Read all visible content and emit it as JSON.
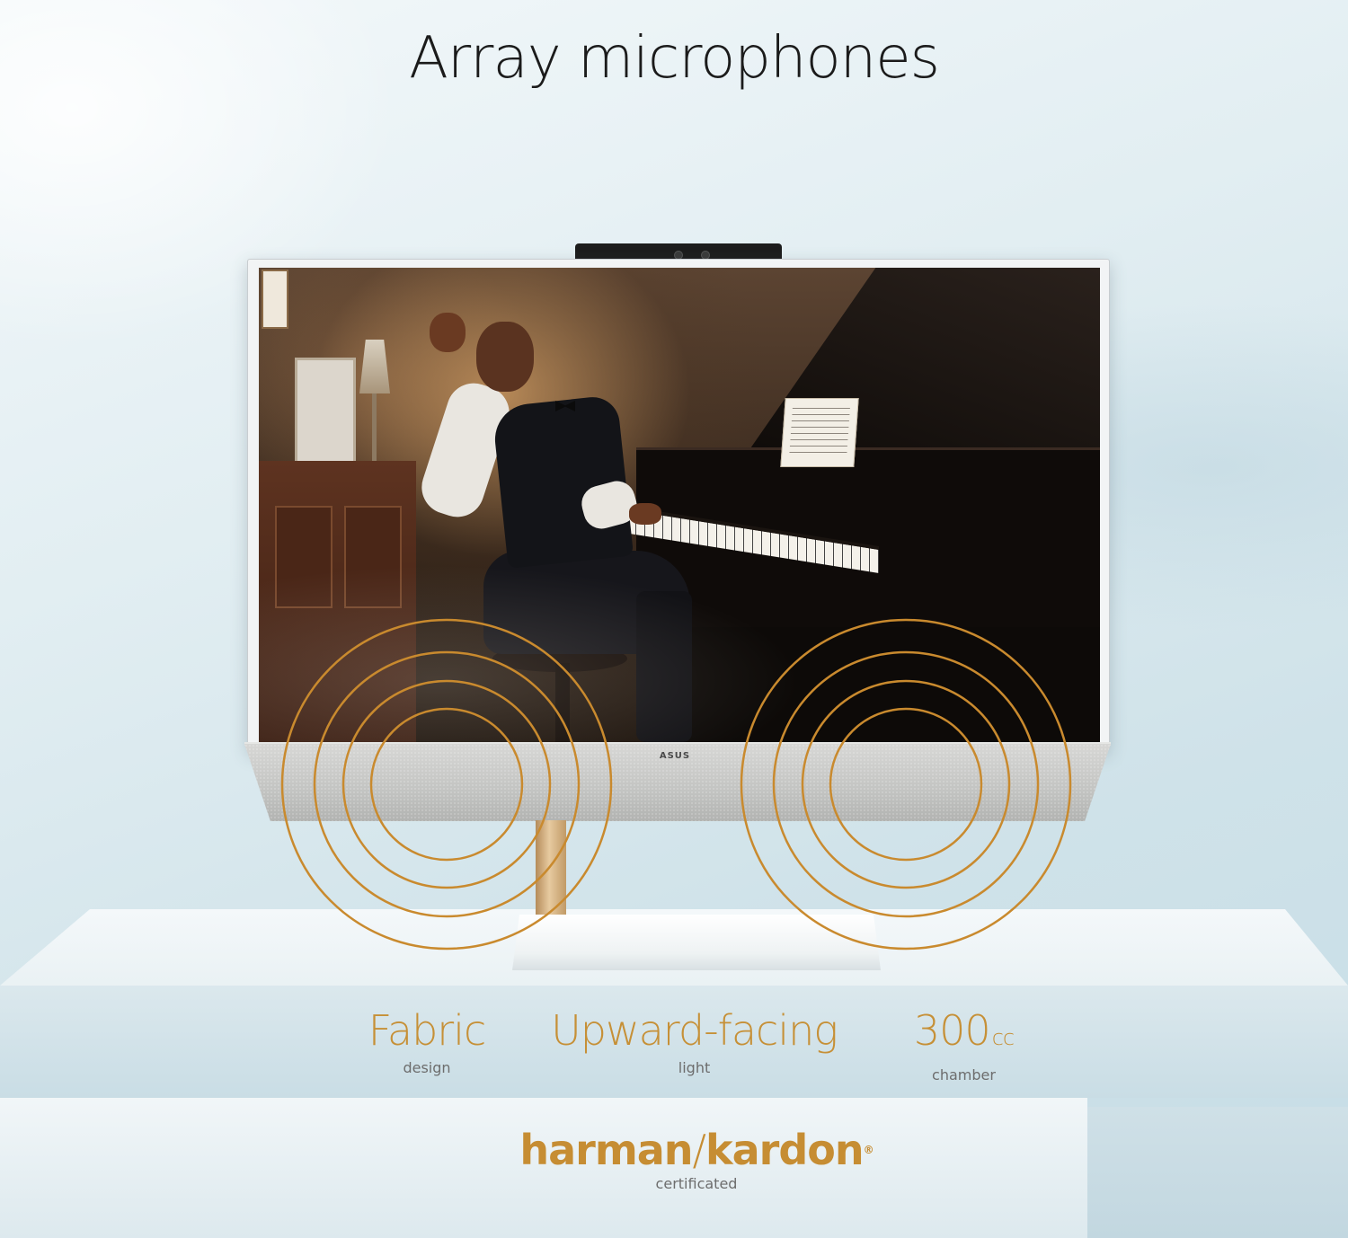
{
  "title": "Array microphones",
  "features": [
    {
      "main": "Fabric",
      "unit": "",
      "sub": "design"
    },
    {
      "main": "Upward-facing",
      "unit": "",
      "sub": "light"
    },
    {
      "main": "300",
      "unit": "cc",
      "sub": "chamber"
    }
  ],
  "brand": {
    "name_left": "harman",
    "separator": "/",
    "name_right": "kardon",
    "registered": "®",
    "sub": "certificated"
  },
  "product": {
    "monitor_logo": "ASUS"
  },
  "colors": {
    "accent_gold": "#c69037",
    "wave_stroke": "#c98a2e",
    "title_text": "#1b1b1b",
    "caption_text": "#6d6d6d"
  },
  "icons": [
    "sound-wave-icon",
    "sound-wave-icon"
  ]
}
